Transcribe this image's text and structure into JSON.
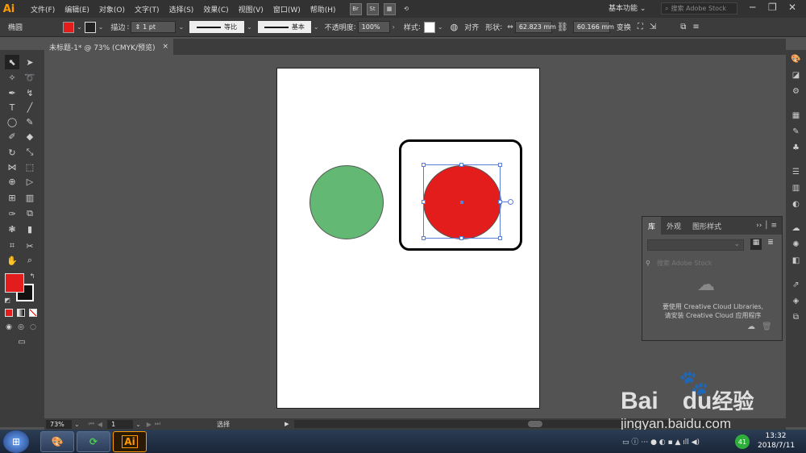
{
  "app": {
    "logo": "Ai"
  },
  "menu": [
    "文件(F)",
    "编辑(E)",
    "对象(O)",
    "文字(T)",
    "选择(S)",
    "效果(C)",
    "视图(V)",
    "窗口(W)",
    "帮助(H)"
  ],
  "menu_buttons": {
    "br": "Br",
    "st": "St"
  },
  "workspace": "基本功能",
  "search_placeholder": "搜索 Adobe Stock",
  "control": {
    "object_type": "椭圆",
    "fill_color": "#e31c1c",
    "stroke_label": "描边",
    "stroke_weight": "1 pt",
    "stroke_profile": "等比",
    "brush": "基本",
    "opacity_label": "不透明度",
    "opacity_value": "100%",
    "style_label": "样式",
    "align_label": "对齐",
    "shape_label": "形状",
    "width": "62.823 mm",
    "height": "60.166 mm",
    "transform_label": "变换"
  },
  "document_tab": {
    "title": "未标题-1* @ 73% (CMYK/预览)",
    "close": "×"
  },
  "canvas": {
    "green_circle_color": "#63b873",
    "red_circle_color": "#e31c1c"
  },
  "library_panel": {
    "tabs": [
      "库",
      "外观",
      "图形样式"
    ],
    "search_placeholder": "搜索 Adobe Stock",
    "message_line1": "要使用 Creative Cloud Libraries,",
    "message_line2": "请安装 Creative Cloud 应用程序"
  },
  "status": {
    "zoom": "73%",
    "page": "1",
    "tool": "选择"
  },
  "taskbar": {
    "time": "13:32",
    "date": "2018/7/11",
    "badge": "41",
    "ai_label": "Ai"
  },
  "watermark": {
    "brand": "Bai",
    "brand2": "du",
    "brand3": "经验",
    "url": "jingyan.baidu.com"
  }
}
